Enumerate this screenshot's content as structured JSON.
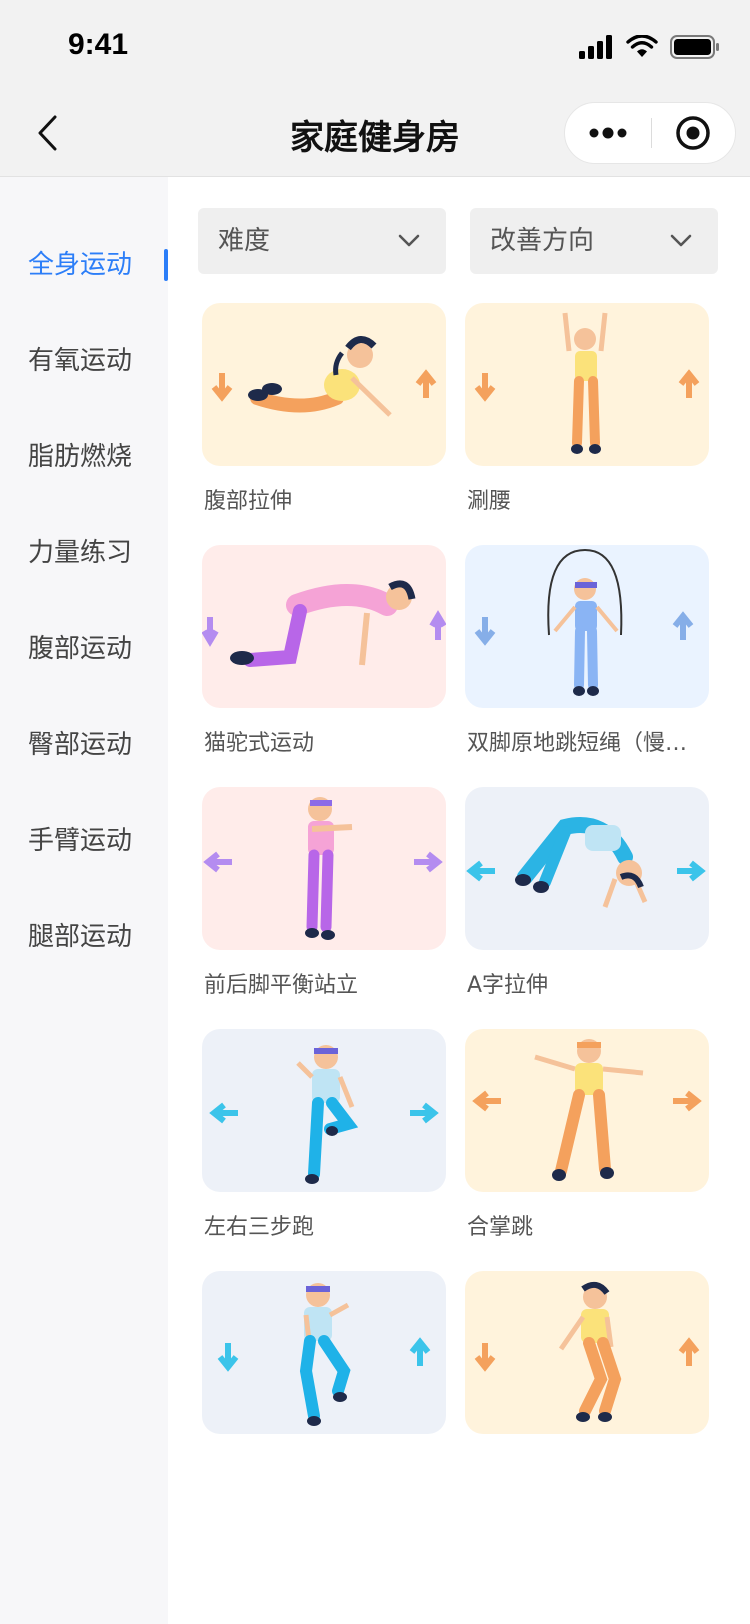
{
  "status": {
    "time": "9:41"
  },
  "nav": {
    "title": "家庭健身房"
  },
  "sidebar": {
    "items": [
      {
        "label": "全身运动",
        "active": true
      },
      {
        "label": "有氧运动",
        "active": false
      },
      {
        "label": "脂肪燃烧",
        "active": false
      },
      {
        "label": "力量练习",
        "active": false
      },
      {
        "label": "腹部运动",
        "active": false
      },
      {
        "label": "臀部运动",
        "active": false
      },
      {
        "label": "手臂运动",
        "active": false
      },
      {
        "label": "腿部运动",
        "active": false
      }
    ]
  },
  "filters": {
    "difficulty_label": "难度",
    "direction_label": "改善方向"
  },
  "colors": {
    "accent": "#2c7ef8",
    "yellow_bg": "#fff3dc",
    "pink_bg": "#ffecea",
    "blue_bg": "#eaf3ff",
    "grey_blue_bg": "#edf1f8"
  },
  "exercises": [
    {
      "title": "腹部拉伸"
    },
    {
      "title": "涮腰"
    },
    {
      "title": "猫驼式运动"
    },
    {
      "title": "双脚原地跳短绳（慢…"
    },
    {
      "title": "前后脚平衡站立"
    },
    {
      "title": "A字拉伸"
    },
    {
      "title": "左右三步跑"
    },
    {
      "title": "合掌跳"
    },
    {
      "title": ""
    },
    {
      "title": ""
    }
  ]
}
